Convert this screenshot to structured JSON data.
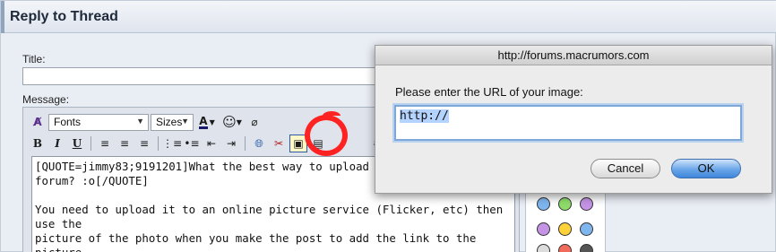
{
  "header": {
    "title": "Reply to Thread"
  },
  "form": {
    "title_label": "Title:",
    "message_label": "Message:",
    "font_select": "Fonts",
    "size_select": "Sizes",
    "message_text": "[QUOTE=jimmy83;9191201]What the best way to upload\nforum? :o[/QUOTE]\n\nYou need to upload it to an online picture service (Flicker, etc) then use the\npicture of the photo when you make the post to add the link to the picture\ninside your post."
  },
  "dialog": {
    "title": "http://forums.macrumors.com",
    "prompt": "Please enter the URL of your image:",
    "input_value": "http://",
    "cancel_label": "Cancel",
    "ok_label": "OK"
  },
  "toolbar": {
    "bold": "B",
    "italic": "I",
    "underline": "U",
    "text_color": "A",
    "hash": "#"
  },
  "colors": {
    "accent": "#3f86dc",
    "annotation": "#ff2222"
  }
}
